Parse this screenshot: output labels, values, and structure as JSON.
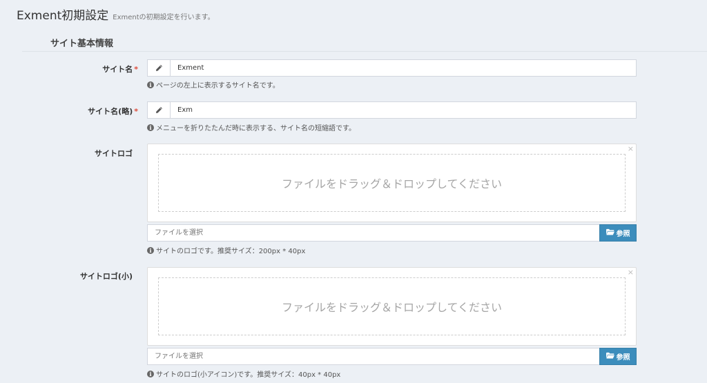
{
  "header": {
    "title": "Exment初期設定",
    "subtitle": "Exmentの初期設定を行います。"
  },
  "section": {
    "title": "サイト基本情報"
  },
  "site_name": {
    "label": "サイト名",
    "required_mark": "*",
    "value": "Exment",
    "help": "ページの左上に表示するサイト名です。",
    "icon": "pencil-icon"
  },
  "site_name_short": {
    "label": "サイト名(略)",
    "required_mark": "*",
    "value": "Exm",
    "help": "メニューを折りたたんだ時に表示する、サイト名の短縮語です。",
    "icon": "pencil-icon"
  },
  "site_logo": {
    "label": "サイトロゴ",
    "drop_text": "ファイルをドラッグ＆ドロップしてください",
    "placeholder": "ファイルを選択",
    "browse_label": "参照",
    "help": "サイトのロゴです。推奨サイズ：200px * 40px",
    "close_glyph": "×"
  },
  "site_logo_small": {
    "label": "サイトロゴ(小)",
    "drop_text": "ファイルをドラッグ＆ドロップしてください",
    "placeholder": "ファイルを選択",
    "browse_label": "参照",
    "help": "サイトのロゴ(小アイコン)です。推奨サイズ：40px * 40px",
    "close_glyph": "×"
  },
  "info_glyph": "i",
  "colors": {
    "background": "#ecf0f5",
    "primary_button": "#3c8dbc",
    "required": "#dd4b39"
  }
}
